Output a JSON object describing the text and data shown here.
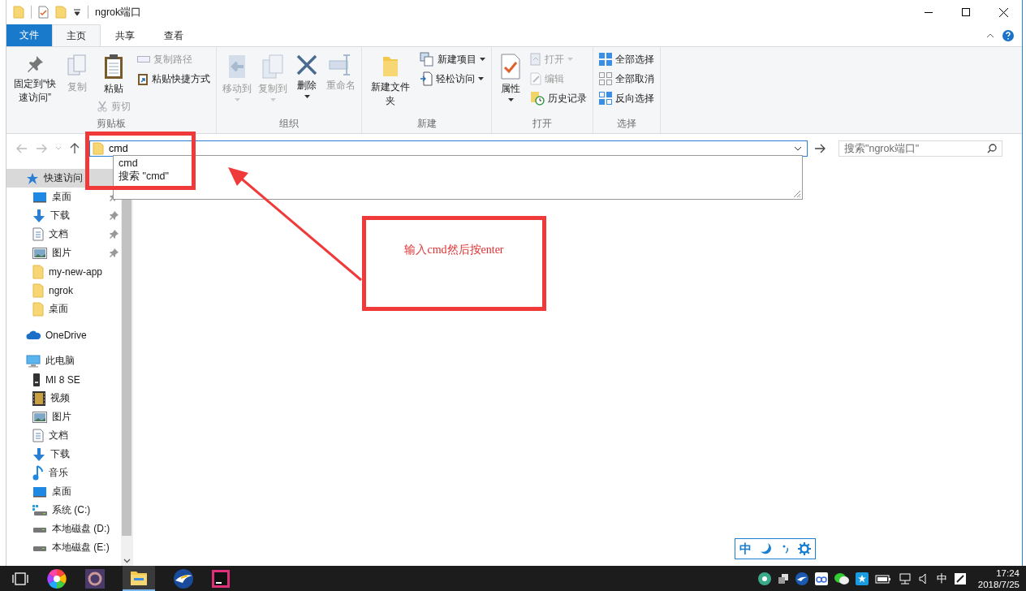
{
  "window": {
    "title": "ngrok端口"
  },
  "ribbon_tabs": [
    {
      "label": "文件",
      "kind": "file",
      "selected": false
    },
    {
      "label": "主页",
      "kind": "tab",
      "selected": true
    },
    {
      "label": "共享",
      "kind": "tab",
      "selected": false
    },
    {
      "label": "查看",
      "kind": "tab",
      "selected": false
    }
  ],
  "ribbon_groups": [
    {
      "label": "剪贴板",
      "columns": [
        [
          {
            "label": "固定到“快速访问”",
            "kind": "large",
            "disabled": false,
            "dropdown": false
          }
        ],
        [
          {
            "label": "复制",
            "kind": "large",
            "disabled": true,
            "dropdown": false
          }
        ],
        [
          {
            "label": "粘贴",
            "kind": "large",
            "disabled": false,
            "dropdown": false
          },
          {
            "label": "剪切",
            "kind": "small",
            "disabled": true,
            "dropdown": false
          }
        ],
        [
          {
            "label": "复制路径",
            "kind": "small",
            "disabled": true,
            "dropdown": false
          },
          {
            "label": "粘贴快捷方式",
            "kind": "small",
            "disabled": false,
            "dropdown": false
          }
        ]
      ]
    },
    {
      "label": "组织",
      "columns": [
        [
          {
            "label": "移动到",
            "kind": "large",
            "disabled": true,
            "dropdown": true
          }
        ],
        [
          {
            "label": "复制到",
            "kind": "large",
            "disabled": true,
            "dropdown": true
          }
        ],
        [
          {
            "label": "删除",
            "kind": "large",
            "disabled": false,
            "dropdown": true
          }
        ],
        [
          {
            "label": "重命名",
            "kind": "large",
            "disabled": true,
            "dropdown": false
          }
        ]
      ]
    },
    {
      "label": "新建",
      "columns": [
        [
          {
            "label": "新建文件夹",
            "kind": "large",
            "disabled": false,
            "dropdown": false
          }
        ],
        [
          {
            "label": "新建项目",
            "kind": "small",
            "disabled": false,
            "dropdown": true
          },
          {
            "label": "轻松访问",
            "kind": "small",
            "disabled": false,
            "dropdown": true
          }
        ]
      ]
    },
    {
      "label": "打开",
      "columns": [
        [
          {
            "label": "属性",
            "kind": "large",
            "disabled": false,
            "dropdown": true
          }
        ],
        [
          {
            "label": "打开",
            "kind": "small",
            "disabled": true,
            "dropdown": true
          },
          {
            "label": "编辑",
            "kind": "small",
            "disabled": true,
            "dropdown": false
          },
          {
            "label": "历史记录",
            "kind": "small",
            "disabled": false,
            "dropdown": false
          }
        ]
      ]
    },
    {
      "label": "选择",
      "columns": [
        [
          {
            "label": "全部选择",
            "kind": "small",
            "disabled": false,
            "dropdown": false
          },
          {
            "label": "全部取消",
            "kind": "small",
            "disabled": false,
            "dropdown": false
          },
          {
            "label": "反向选择",
            "kind": "small",
            "disabled": false,
            "dropdown": false
          }
        ]
      ]
    }
  ],
  "address_bar": {
    "value": "cmd",
    "suggestions": [
      "cmd",
      "搜索 \"cmd\""
    ]
  },
  "search": {
    "placeholder": "搜索\"ngrok端口\""
  },
  "navigation": [
    {
      "label": "快速访问",
      "kind": "quick",
      "selected": true,
      "pinned": false,
      "children": [
        {
          "label": "桌面",
          "kind": "desktop",
          "selected": false,
          "pinned": true
        },
        {
          "label": "下载",
          "kind": "download",
          "selected": false,
          "pinned": true
        },
        {
          "label": "文档",
          "kind": "doc",
          "selected": false,
          "pinned": true
        },
        {
          "label": "图片",
          "kind": "pictures",
          "selected": false,
          "pinned": true
        },
        {
          "label": "my-new-app",
          "kind": "folder",
          "selected": false,
          "pinned": false
        },
        {
          "label": "ngrok",
          "kind": "folder",
          "selected": false,
          "pinned": false
        },
        {
          "label": "桌面",
          "kind": "folder",
          "selected": false,
          "pinned": false
        }
      ]
    },
    {
      "label": "OneDrive",
      "kind": "cloud",
      "selected": false,
      "pinned": false
    },
    {
      "label": "此电脑",
      "kind": "pc",
      "selected": false,
      "pinned": false,
      "children": [
        {
          "label": "MI 8 SE",
          "kind": "phone",
          "selected": false,
          "pinned": false
        },
        {
          "label": "视频",
          "kind": "video",
          "selected": false,
          "pinned": false
        },
        {
          "label": "图片",
          "kind": "pictures",
          "selected": false,
          "pinned": false
        },
        {
          "label": "文档",
          "kind": "doc",
          "selected": false,
          "pinned": false
        },
        {
          "label": "下载",
          "kind": "download",
          "selected": false,
          "pinned": false
        },
        {
          "label": "音乐",
          "kind": "music",
          "selected": false,
          "pinned": false
        },
        {
          "label": "桌面",
          "kind": "desktop",
          "selected": false,
          "pinned": false
        },
        {
          "label": "系统 (C:)",
          "kind": "system-drive",
          "selected": false,
          "pinned": false
        },
        {
          "label": "本地磁盘 (D:)",
          "kind": "drive",
          "selected": false,
          "pinned": false
        },
        {
          "label": "本地磁盘 (E:)",
          "kind": "drive",
          "selected": false,
          "pinned": false
        }
      ]
    }
  ],
  "annotation": {
    "note": "输入cmd然后按enter"
  },
  "ime_toolbar": {
    "mode": "中"
  },
  "taskbar": {
    "input_indicator": "中",
    "time": "17:24",
    "date": "2018/7/25"
  }
}
